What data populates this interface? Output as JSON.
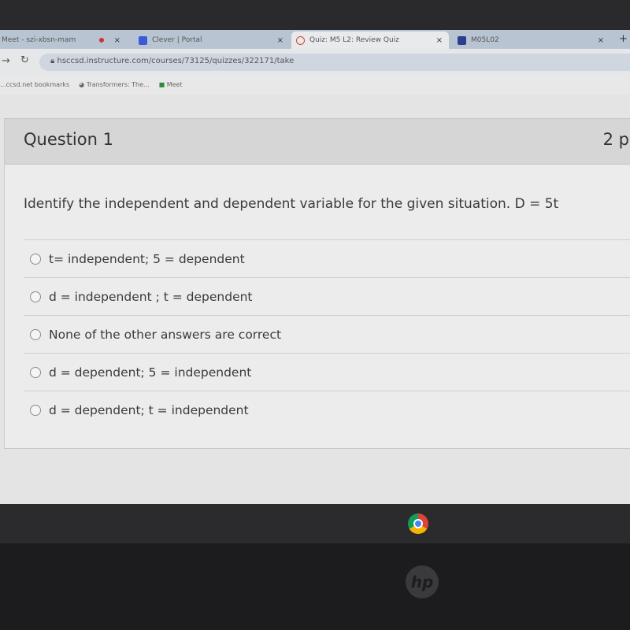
{
  "browser": {
    "tabs": [
      {
        "title": "Meet - szi-xbsn-mam",
        "active": false
      },
      {
        "title": "Clever | Portal",
        "active": false
      },
      {
        "title": "Quiz: M5 L2: Review Quiz",
        "active": true
      },
      {
        "title": "M05L02",
        "active": false
      }
    ],
    "close_label": "×",
    "new_tab_label": "+",
    "url": "hsccsd.instructure.com/courses/73125/quizzes/322171/take",
    "bookmarks": [
      "...ccsd.net bookmarks",
      "Transformers: The...",
      "Meet"
    ]
  },
  "question": {
    "title": "Question 1",
    "points": "2 p",
    "text": "Identify the independent and dependent variable for the given situation. D = 5t",
    "answers": [
      "t= independent; 5 = dependent",
      "d = independent ; t = dependent",
      "None of the other answers are correct",
      "d = dependent; 5 = independent",
      "d = dependent; t = independent"
    ]
  },
  "taskbar": {
    "apps": [
      "chrome-icon"
    ]
  },
  "device": {
    "logo": "hp"
  }
}
